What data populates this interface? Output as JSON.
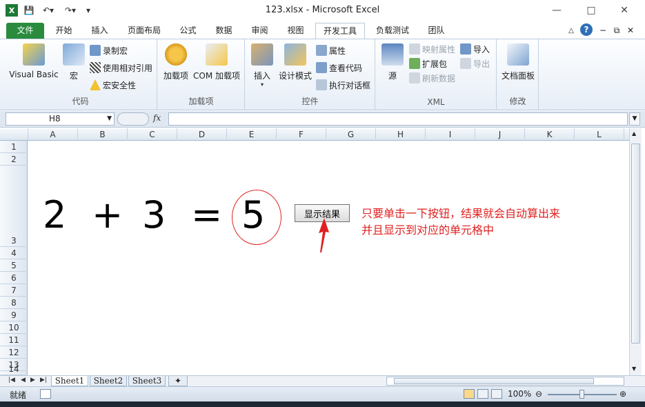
{
  "window": {
    "title": "123.xlsx - Microsoft Excel"
  },
  "tabs": [
    "文件",
    "开始",
    "插入",
    "页面布局",
    "公式",
    "数据",
    "审阅",
    "视图",
    "开发工具",
    "负载测试",
    "团队"
  ],
  "ribbon": {
    "code_group": {
      "label": "代码",
      "visual_basic": "Visual Basic",
      "macro": "宏",
      "record_macro": "录制宏",
      "relative_ref": "使用相对引用",
      "macro_security": "宏安全性"
    },
    "addins_group": {
      "label": "加载项",
      "addins": "加载项",
      "com_addins": "COM 加载项"
    },
    "controls_group": {
      "label": "控件",
      "insert": "插入",
      "design_mode": "设计模式",
      "properties": "属性",
      "view_code": "查看代码",
      "run_dialog": "执行对话框"
    },
    "xml_group": {
      "label": "XML",
      "source": "源",
      "map_properties": "映射属性",
      "expansion_packs": "扩展包",
      "refresh_data": "刷新数据",
      "import": "导入",
      "export": "导出"
    },
    "modify_group": {
      "label": "修改",
      "doc_panel": "文档面板"
    }
  },
  "formula_bar": {
    "name_box": "H8",
    "fx": "fx",
    "value": ""
  },
  "columns": [
    "A",
    "B",
    "C",
    "D",
    "E",
    "F",
    "G",
    "H",
    "I",
    "J",
    "K",
    "L"
  ],
  "rows": [
    "1",
    "2",
    "3",
    "4",
    "5",
    "6",
    "7",
    "8",
    "9",
    "10",
    "11",
    "12",
    "13",
    "14"
  ],
  "sheet_content": {
    "cell_a3": "2",
    "cell_b3": "+",
    "cell_c3": "3",
    "cell_d3": "=",
    "cell_e3": "5",
    "button_label": "显示结果",
    "note_line1": "只要单击一下按钮，结果就会自动算出来",
    "note_line2": "并且显示到对应的单元格中"
  },
  "sheets": [
    "Sheet1",
    "Sheet2",
    "Sheet3"
  ],
  "status": {
    "ready": "就绪",
    "zoom": "100%"
  },
  "colors": {
    "file_tab": "#2a8b3e",
    "annotation": "#e02020"
  }
}
